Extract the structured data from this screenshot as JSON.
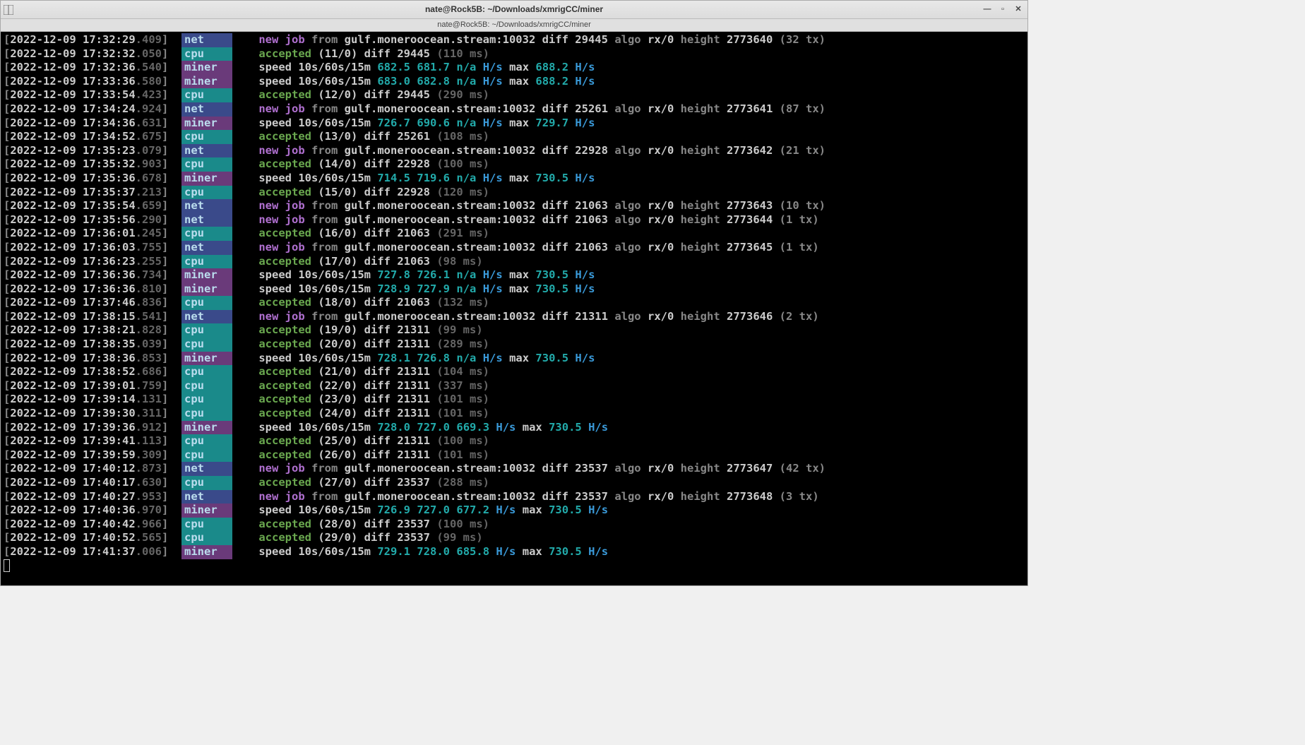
{
  "title": "nate@Rock5B: ~/Downloads/xmrigCC/miner",
  "tab": "nate@Rock5B: ~/Downloads/xmrigCC/miner",
  "pool": "gulf.moneroocean.stream:10032",
  "lines": [
    {
      "ts": "2022-12-09 17:32:29",
      "ms": ".409",
      "tag": "net",
      "type": "job",
      "diff": "29445",
      "algo": "rx/0",
      "height": "2773640",
      "tx": "(32 tx)"
    },
    {
      "ts": "2022-12-09 17:32:32",
      "ms": ".050",
      "tag": "cpu",
      "type": "acc",
      "cnt": "(11/0)",
      "diff": "29445",
      "lat": "(110 ms)"
    },
    {
      "ts": "2022-12-09 17:32:36",
      "ms": ".540",
      "tag": "miner",
      "type": "speed",
      "s1": "682.5",
      "s2": "681.7",
      "s3": "n/a",
      "max": "688.2"
    },
    {
      "ts": "2022-12-09 17:33:36",
      "ms": ".580",
      "tag": "miner",
      "type": "speed",
      "s1": "683.0",
      "s2": "682.8",
      "s3": "n/a",
      "max": "688.2"
    },
    {
      "ts": "2022-12-09 17:33:54",
      "ms": ".423",
      "tag": "cpu",
      "type": "acc",
      "cnt": "(12/0)",
      "diff": "29445",
      "lat": "(290 ms)"
    },
    {
      "ts": "2022-12-09 17:34:24",
      "ms": ".924",
      "tag": "net",
      "type": "job",
      "diff": "25261",
      "algo": "rx/0",
      "height": "2773641",
      "tx": "(87 tx)"
    },
    {
      "ts": "2022-12-09 17:34:36",
      "ms": ".631",
      "tag": "miner",
      "type": "speed",
      "s1": "726.7",
      "s2": "690.6",
      "s3": "n/a",
      "max": "729.7"
    },
    {
      "ts": "2022-12-09 17:34:52",
      "ms": ".675",
      "tag": "cpu",
      "type": "acc",
      "cnt": "(13/0)",
      "diff": "25261",
      "lat": "(108 ms)"
    },
    {
      "ts": "2022-12-09 17:35:23",
      "ms": ".079",
      "tag": "net",
      "type": "job",
      "diff": "22928",
      "algo": "rx/0",
      "height": "2773642",
      "tx": "(21 tx)"
    },
    {
      "ts": "2022-12-09 17:35:32",
      "ms": ".903",
      "tag": "cpu",
      "type": "acc",
      "cnt": "(14/0)",
      "diff": "22928",
      "lat": "(100 ms)"
    },
    {
      "ts": "2022-12-09 17:35:36",
      "ms": ".678",
      "tag": "miner",
      "type": "speed",
      "s1": "714.5",
      "s2": "719.6",
      "s3": "n/a",
      "max": "730.5"
    },
    {
      "ts": "2022-12-09 17:35:37",
      "ms": ".213",
      "tag": "cpu",
      "type": "acc",
      "cnt": "(15/0)",
      "diff": "22928",
      "lat": "(120 ms)"
    },
    {
      "ts": "2022-12-09 17:35:54",
      "ms": ".659",
      "tag": "net",
      "type": "job",
      "diff": "21063",
      "algo": "rx/0",
      "height": "2773643",
      "tx": "(10 tx)"
    },
    {
      "ts": "2022-12-09 17:35:56",
      "ms": ".290",
      "tag": "net",
      "type": "job",
      "diff": "21063",
      "algo": "rx/0",
      "height": "2773644",
      "tx": "(1 tx)"
    },
    {
      "ts": "2022-12-09 17:36:01",
      "ms": ".245",
      "tag": "cpu",
      "type": "acc",
      "cnt": "(16/0)",
      "diff": "21063",
      "lat": "(291 ms)"
    },
    {
      "ts": "2022-12-09 17:36:03",
      "ms": ".755",
      "tag": "net",
      "type": "job",
      "diff": "21063",
      "algo": "rx/0",
      "height": "2773645",
      "tx": "(1 tx)"
    },
    {
      "ts": "2022-12-09 17:36:23",
      "ms": ".255",
      "tag": "cpu",
      "type": "acc",
      "cnt": "(17/0)",
      "diff": "21063",
      "lat": "(98 ms)"
    },
    {
      "ts": "2022-12-09 17:36:36",
      "ms": ".734",
      "tag": "miner",
      "type": "speed",
      "s1": "727.8",
      "s2": "726.1",
      "s3": "n/a",
      "max": "730.5"
    },
    {
      "ts": "2022-12-09 17:36:36",
      "ms": ".810",
      "tag": "miner",
      "type": "speed",
      "s1": "728.9",
      "s2": "727.9",
      "s3": "n/a",
      "max": "730.5"
    },
    {
      "ts": "2022-12-09 17:37:46",
      "ms": ".836",
      "tag": "cpu",
      "type": "acc",
      "cnt": "(18/0)",
      "diff": "21063",
      "lat": "(132 ms)"
    },
    {
      "ts": "2022-12-09 17:38:15",
      "ms": ".541",
      "tag": "net",
      "type": "job",
      "diff": "21311",
      "algo": "rx/0",
      "height": "2773646",
      "tx": "(2 tx)"
    },
    {
      "ts": "2022-12-09 17:38:21",
      "ms": ".828",
      "tag": "cpu",
      "type": "acc",
      "cnt": "(19/0)",
      "diff": "21311",
      "lat": "(99 ms)"
    },
    {
      "ts": "2022-12-09 17:38:35",
      "ms": ".039",
      "tag": "cpu",
      "type": "acc",
      "cnt": "(20/0)",
      "diff": "21311",
      "lat": "(289 ms)"
    },
    {
      "ts": "2022-12-09 17:38:36",
      "ms": ".853",
      "tag": "miner",
      "type": "speed",
      "s1": "728.1",
      "s2": "726.8",
      "s3": "n/a",
      "max": "730.5"
    },
    {
      "ts": "2022-12-09 17:38:52",
      "ms": ".686",
      "tag": "cpu",
      "type": "acc",
      "cnt": "(21/0)",
      "diff": "21311",
      "lat": "(104 ms)"
    },
    {
      "ts": "2022-12-09 17:39:01",
      "ms": ".759",
      "tag": "cpu",
      "type": "acc",
      "cnt": "(22/0)",
      "diff": "21311",
      "lat": "(337 ms)"
    },
    {
      "ts": "2022-12-09 17:39:14",
      "ms": ".131",
      "tag": "cpu",
      "type": "acc",
      "cnt": "(23/0)",
      "diff": "21311",
      "lat": "(101 ms)"
    },
    {
      "ts": "2022-12-09 17:39:30",
      "ms": ".311",
      "tag": "cpu",
      "type": "acc",
      "cnt": "(24/0)",
      "diff": "21311",
      "lat": "(101 ms)"
    },
    {
      "ts": "2022-12-09 17:39:36",
      "ms": ".912",
      "tag": "miner",
      "type": "speed",
      "s1": "728.0",
      "s2": "727.0",
      "s3": "669.3",
      "max": "730.5"
    },
    {
      "ts": "2022-12-09 17:39:41",
      "ms": ".113",
      "tag": "cpu",
      "type": "acc",
      "cnt": "(25/0)",
      "diff": "21311",
      "lat": "(100 ms)"
    },
    {
      "ts": "2022-12-09 17:39:59",
      "ms": ".309",
      "tag": "cpu",
      "type": "acc",
      "cnt": "(26/0)",
      "diff": "21311",
      "lat": "(101 ms)"
    },
    {
      "ts": "2022-12-09 17:40:12",
      "ms": ".873",
      "tag": "net",
      "type": "job",
      "diff": "23537",
      "algo": "rx/0",
      "height": "2773647",
      "tx": "(42 tx)"
    },
    {
      "ts": "2022-12-09 17:40:17",
      "ms": ".630",
      "tag": "cpu",
      "type": "acc",
      "cnt": "(27/0)",
      "diff": "23537",
      "lat": "(288 ms)"
    },
    {
      "ts": "2022-12-09 17:40:27",
      "ms": ".953",
      "tag": "net",
      "type": "job",
      "diff": "23537",
      "algo": "rx/0",
      "height": "2773648",
      "tx": "(3 tx)"
    },
    {
      "ts": "2022-12-09 17:40:36",
      "ms": ".970",
      "tag": "miner",
      "type": "speed",
      "s1": "726.9",
      "s2": "727.0",
      "s3": "677.2",
      "max": "730.5"
    },
    {
      "ts": "2022-12-09 17:40:42",
      "ms": ".966",
      "tag": "cpu",
      "type": "acc",
      "cnt": "(28/0)",
      "diff": "23537",
      "lat": "(100 ms)"
    },
    {
      "ts": "2022-12-09 17:40:52",
      "ms": ".565",
      "tag": "cpu",
      "type": "acc",
      "cnt": "(29/0)",
      "diff": "23537",
      "lat": "(99 ms)"
    },
    {
      "ts": "2022-12-09 17:41:37",
      "ms": ".006",
      "tag": "miner",
      "type": "speed",
      "s1": "729.1",
      "s2": "728.0",
      "s3": "685.8",
      "max": "730.5"
    }
  ]
}
